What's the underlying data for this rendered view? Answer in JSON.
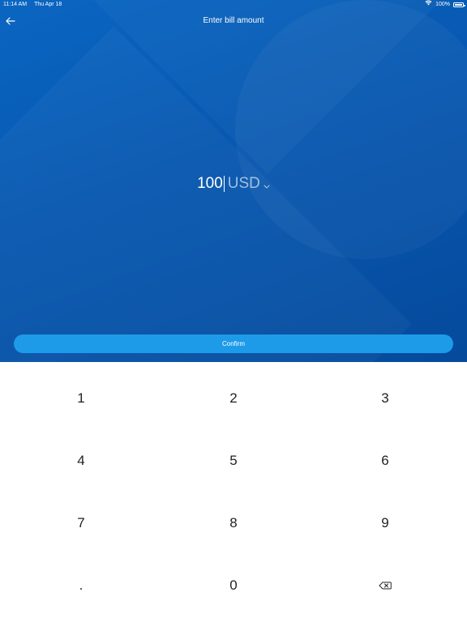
{
  "status_bar": {
    "time": "11:14 AM",
    "date": "Thu Apr 18",
    "battery_text": "100%",
    "icons": [
      "wifi-icon",
      "battery-icon"
    ]
  },
  "header": {
    "title": "Enter bill amount",
    "back_icon": "arrow-left-icon"
  },
  "amount": {
    "value": "100",
    "currency": "USD",
    "currency_icon": "chevron-down-icon"
  },
  "confirm": {
    "label": "Confirm"
  },
  "keypad": {
    "keys": [
      "1",
      "2",
      "3",
      "4",
      "5",
      "6",
      "7",
      "8",
      "9",
      ".",
      "0"
    ],
    "backspace_icon": "backspace-icon"
  },
  "colors": {
    "hero_background": "#0a5db8",
    "confirm_button": "#1e9be8",
    "keypad_text": "#222222"
  }
}
